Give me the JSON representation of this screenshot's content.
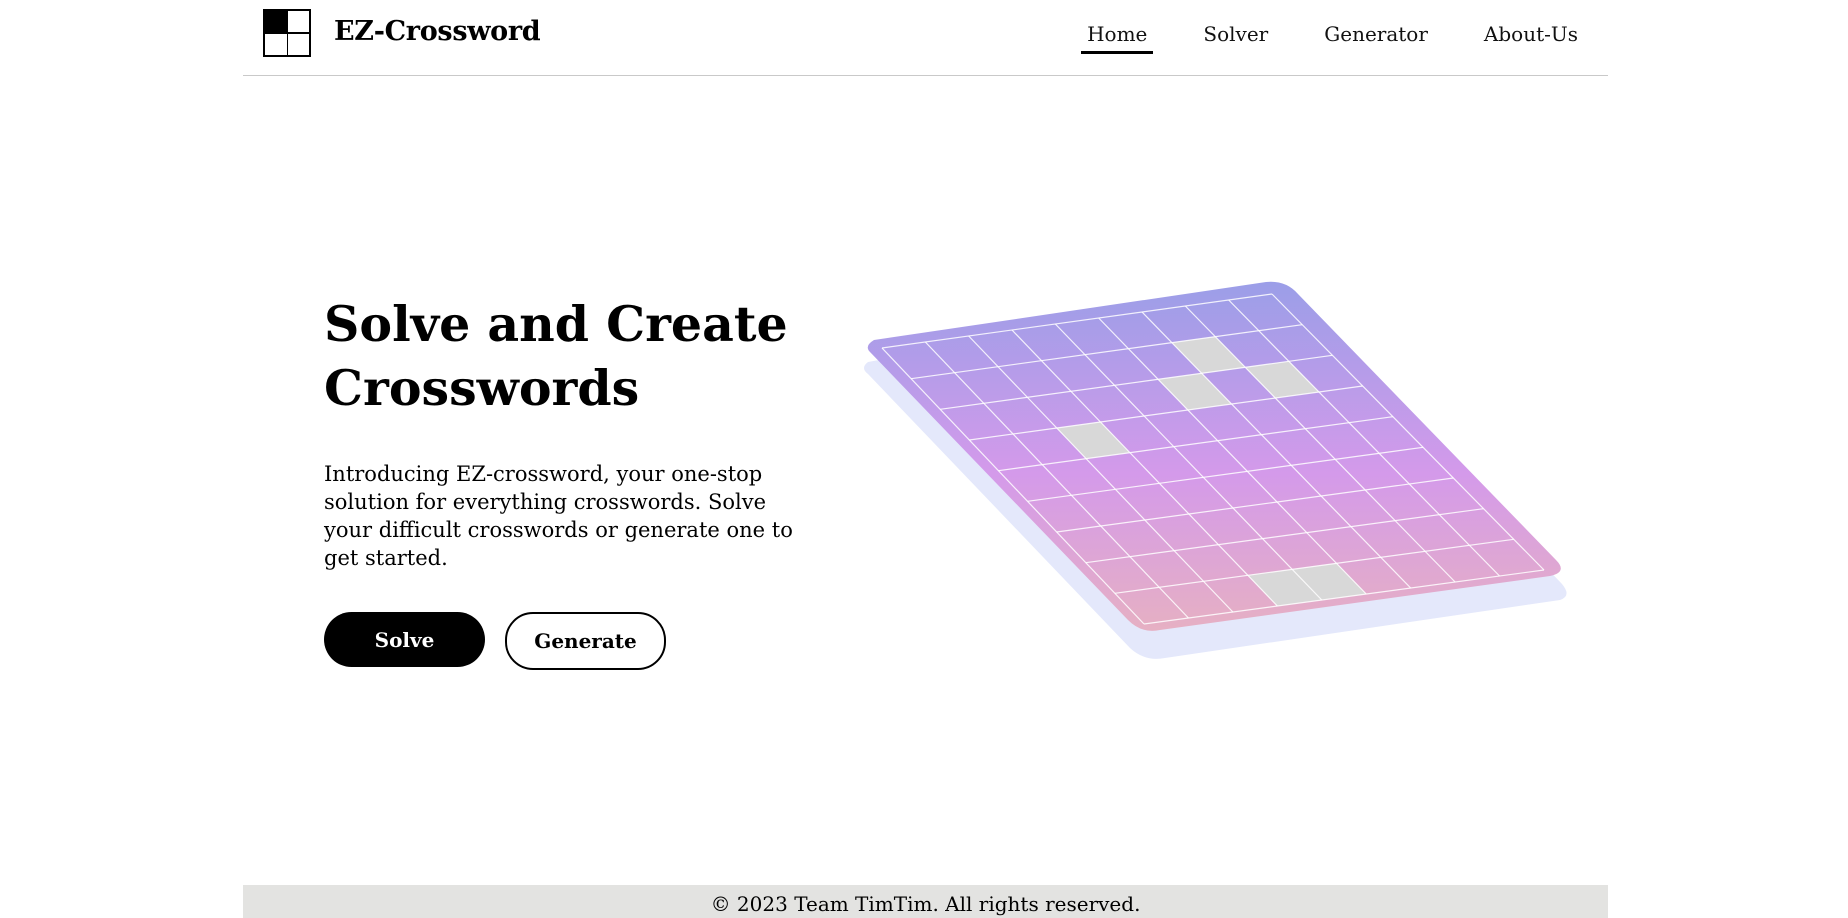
{
  "header": {
    "brand": "EZ-Crossword",
    "nav": [
      {
        "label": "Home",
        "active": true
      },
      {
        "label": "Solver",
        "active": false
      },
      {
        "label": "Generator",
        "active": false
      },
      {
        "label": "About-Us",
        "active": false
      }
    ]
  },
  "hero": {
    "title": "Solve and Create Crosswords",
    "description": "Introducing EZ-crossword, your one-stop solution for everything crosswords. Solve your difficult crosswords or generate one to get started.",
    "solve_button": "Solve",
    "generate_button": "Generate"
  },
  "illustration": {
    "grid_size": 9,
    "shaded_cells": [
      [
        1,
        6
      ],
      [
        2,
        5
      ],
      [
        2,
        7
      ],
      [
        3,
        2
      ],
      [
        8,
        3
      ],
      [
        8,
        4
      ]
    ],
    "gradient": [
      "#9b9ee8",
      "#d49aea",
      "#e6b0c3"
    ],
    "shadow_color": "#e4e8fb",
    "shaded_cell_color": "#d8d8d8"
  },
  "footer": {
    "copyright": "© 2023 Team TimTim. All rights reserved."
  }
}
